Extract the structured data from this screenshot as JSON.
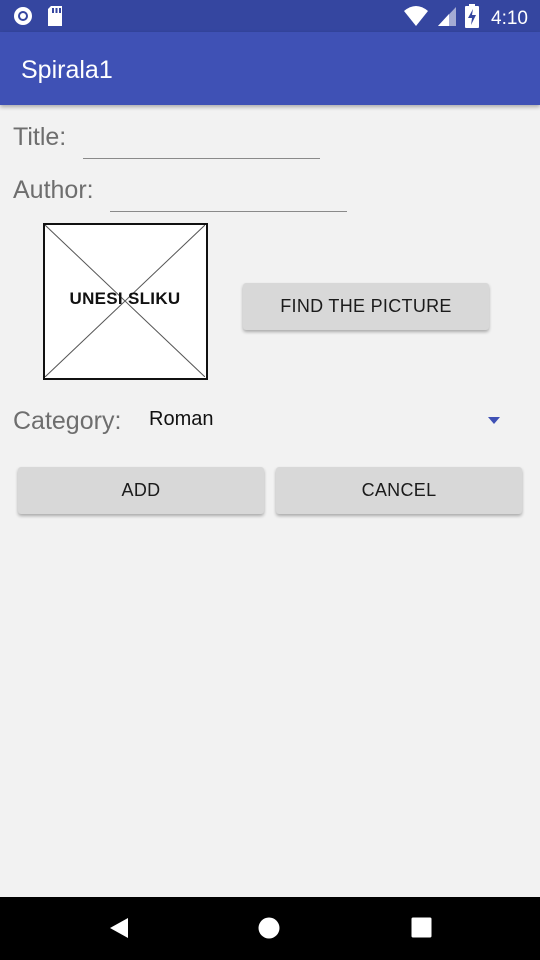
{
  "status_bar": {
    "time": "4:10",
    "left_icons": [
      "circle-notification-icon",
      "sd-card-icon"
    ],
    "right_icons": [
      "wifi-icon",
      "cellular-signal-icon",
      "battery-charging-icon"
    ]
  },
  "app_bar": {
    "title": "Spirala1",
    "color": "#3f51b5"
  },
  "form": {
    "title_label": "Title:",
    "title_value": "",
    "author_label": "Author:",
    "author_value": "",
    "image_placeholder_text": "UNESI SLIKU",
    "find_picture_button": "FIND THE PICTURE",
    "category_label": "Category:",
    "category_selected": "Roman",
    "add_button": "ADD",
    "cancel_button": "CANCEL"
  },
  "nav_bar": {
    "buttons": [
      "back-icon",
      "home-icon",
      "recents-icon"
    ]
  }
}
